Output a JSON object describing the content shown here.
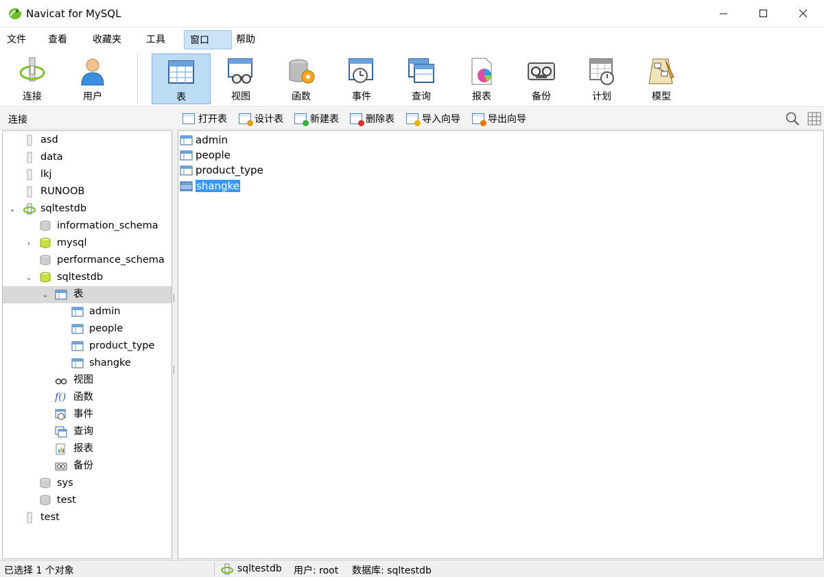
{
  "window": {
    "title": "Navicat for MySQL",
    "minimize": "—",
    "maximize": "☐",
    "close": "✕"
  },
  "menu": [
    "文件",
    "查看",
    "收藏夹",
    "工具",
    "窗口",
    "帮助"
  ],
  "toolbar": {
    "connect": "连接",
    "user": "用户",
    "table": "表",
    "view": "视图",
    "function": "函数",
    "event": "事件",
    "query": "查询",
    "report": "报表",
    "backup": "备份",
    "schedule": "计划",
    "model": "模型"
  },
  "subbar": {
    "connection_label": "连接",
    "open_table": "打开表",
    "design_table": "设计表",
    "new_table": "新建表",
    "delete_table": "删除表",
    "import_wizard": "导入向导",
    "export_wizard": "导出向导"
  },
  "tree": {
    "asd": "asd",
    "data": "data",
    "lkj": "lkj",
    "runoob": "RUNOOB",
    "sqltestdb_conn": "sqltestdb",
    "information_schema": "information_schema",
    "mysql": "mysql",
    "performance_schema": "performance_schema",
    "sqltestdb_db": "sqltestdb",
    "tables": "表",
    "admin": "admin",
    "people": "people",
    "product_type": "product_type",
    "shangke": "shangke",
    "views": "视图",
    "functions": "函数",
    "events": "事件",
    "queries": "查询",
    "reports": "报表",
    "backups": "备份",
    "sys": "sys",
    "test_db": "test",
    "test_conn": "test"
  },
  "content": {
    "tables": [
      "admin",
      "people",
      "product_type",
      "shangke"
    ],
    "selected": "shangke"
  },
  "status": {
    "selection": "已选择 1 个对象",
    "connection": "sqltestdb",
    "user": "用户: root",
    "database": "数据库: sqltestdb"
  }
}
